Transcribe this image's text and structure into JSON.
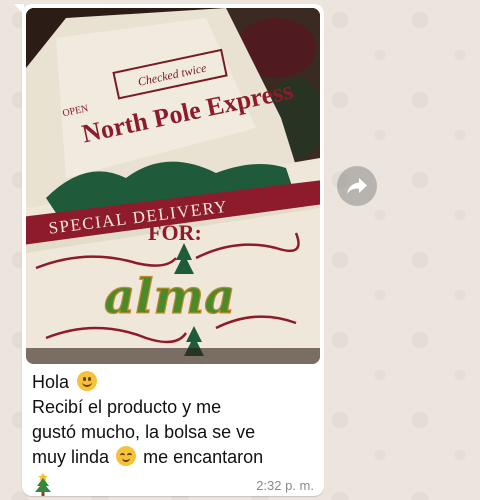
{
  "message": {
    "image": {
      "description_icon": "photo-of-santa-sack",
      "sack_text": {
        "top_banner": "North Pole Express",
        "top_tag": "Checked twice",
        "tag_open": "OPEN",
        "ribbon": "SPECIAL DELIVERY",
        "for_label": "FOR:",
        "name": "alma"
      }
    },
    "caption_lines": [
      "Hola",
      "Recibí  el producto y me",
      "gustó mucho, la bolsa se ve",
      "muy linda",
      "me encantaron"
    ],
    "emoji_greeting": "slightly-smiling-face",
    "emoji_relieved": "relieved-face",
    "emoji_tree": "christmas-tree",
    "timestamp": "2:32 p. m."
  },
  "actions": {
    "forward_icon": "forward-arrow-icon"
  },
  "colors": {
    "wallpaper": "#ece5dd",
    "bubble": "#ffffff",
    "ribbon_red": "#8e1b2b",
    "tree_green": "#1f5a3a",
    "glitter_name": "#4a8a2a"
  }
}
